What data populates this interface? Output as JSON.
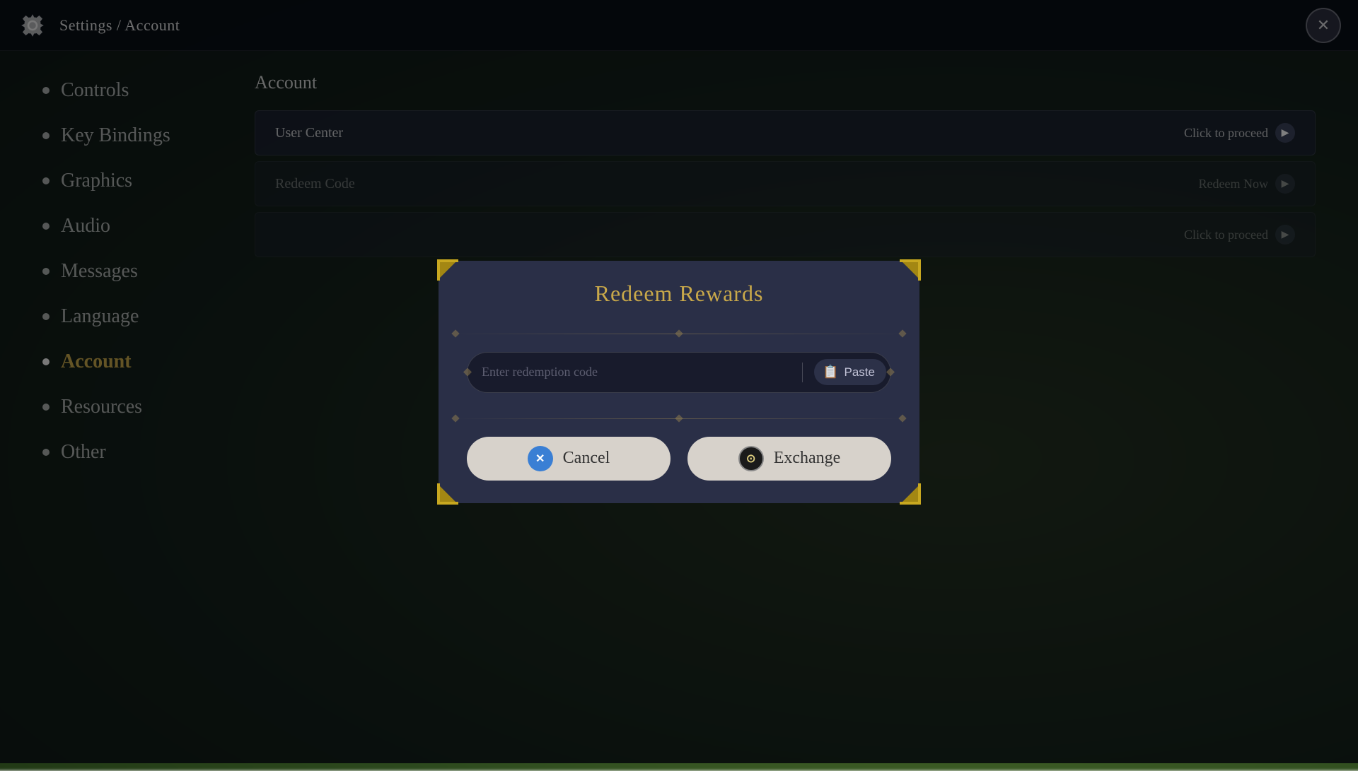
{
  "topbar": {
    "title": "Settings / Account",
    "close_label": "✕"
  },
  "sidebar": {
    "items": [
      {
        "id": "controls",
        "label": "Controls",
        "active": false
      },
      {
        "id": "key-bindings",
        "label": "Key Bindings",
        "active": false
      },
      {
        "id": "graphics",
        "label": "Graphics",
        "active": false
      },
      {
        "id": "audio",
        "label": "Audio",
        "active": false
      },
      {
        "id": "messages",
        "label": "Messages",
        "active": false
      },
      {
        "id": "language",
        "label": "Language",
        "active": false
      },
      {
        "id": "account",
        "label": "Account",
        "active": true
      },
      {
        "id": "resources",
        "label": "Resources",
        "active": false
      },
      {
        "id": "other",
        "label": "Other",
        "active": false
      }
    ]
  },
  "content": {
    "title": "Account",
    "rows": [
      {
        "id": "user-center",
        "label": "User Center",
        "action": "Click to proceed"
      },
      {
        "id": "redeem-code",
        "label": "Redeem Code",
        "action": "Redeem Now"
      },
      {
        "id": "third-party",
        "label": "",
        "action": "Click to proceed"
      }
    ]
  },
  "modal": {
    "title": "Redeem Rewards",
    "input_placeholder": "Enter redemption code",
    "paste_label": "Paste",
    "cancel_label": "Cancel",
    "exchange_label": "Exchange"
  }
}
